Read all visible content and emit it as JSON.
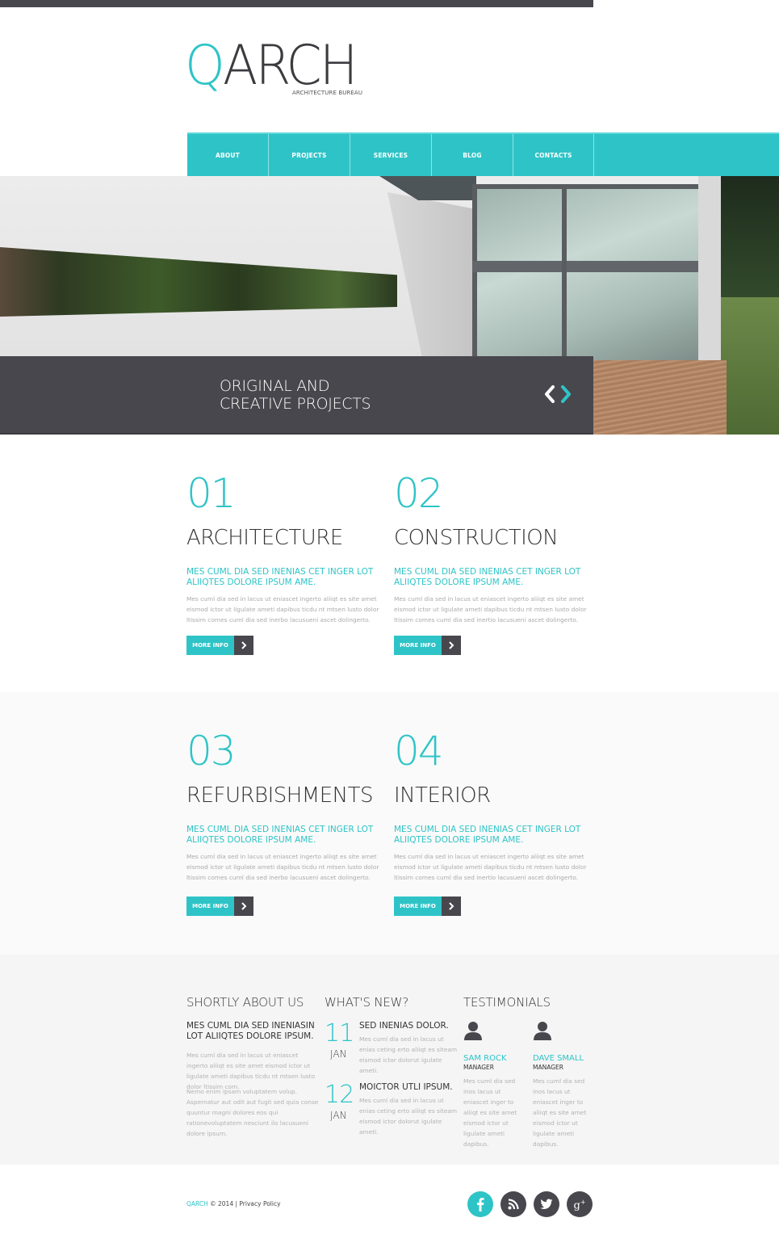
{
  "brand": {
    "logo_q": "Q",
    "logo_rest": "ARCH",
    "tagline": "ARCHITECTURE BUREAU",
    "accent_color": "#2ec4c7",
    "dark_color": "#48474d"
  },
  "nav": {
    "items": [
      {
        "label": "ABOUT"
      },
      {
        "label": "PROJECTS"
      },
      {
        "label": "SERVICES"
      },
      {
        "label": "BLOG"
      },
      {
        "label": "CONTACTS"
      }
    ]
  },
  "hero": {
    "caption_line1": "ORIGINAL AND",
    "caption_line2": "CREATIVE PROJECTS",
    "prev_icon": "chevron-left-icon",
    "next_icon": "chevron-right-icon"
  },
  "services": [
    {
      "number": "01",
      "title": "ARCHITECTURE",
      "subtitle": "MES CUML DIA SED INENIAS CET INGER LOT ALIIQTES DOLORE IPSUM AME.",
      "body": "Mes cuml dia sed in lacus ut eniascet ingerto aliiqt es site amet eismod ictor ut ligulate ameti dapibus ticdu nt mtsen lusto dolor ltissim comes cuml dia sed inerbo lacusueni ascet dolingerto.",
      "button": "MORE INFO"
    },
    {
      "number": "02",
      "title": "CONSTRUCTION",
      "subtitle": "MES CUML DIA SED INENIAS CET INGER LOT ALIIQTES DOLORE IPSUM AME.",
      "body": "Mes cuml dia sed in lacus ut eniascet ingerto aliiqt es site amet eismod ictor ut ligulate ameti dapibus ticdu nt mtsen lusto dolor ltissim comes cuml dia sed inertio lacusueni ascet dolingerto.",
      "button": "MORE INFO"
    },
    {
      "number": "03",
      "title": "REFURBISHMENTS",
      "subtitle": "MES CUML DIA SED INENIAS CET INGER LOT ALIIQTES DOLORE IPSUM AME.",
      "body": "Mes cuml dia sed in lacus ut eniascet ingerto aliiqt es site amet eismod ictor ut ligulate ameti dapibus ticdu nt mtsen lusto dolor ltissim comes cuml dia sed inerbo lacusueni ascet dolingerto.",
      "button": "MORE INFO"
    },
    {
      "number": "04",
      "title": "INTERIOR",
      "subtitle": "MES CUML DIA SED INENIAS CET INGER LOT ALIIQTES DOLORE IPSUM AME.",
      "body": "Mes cuml dia sed in lacus ut eniascet ingerto aliiqt es site amet eismod ictor ut ligulate ameti dapibus ticdu nt mtsen lusto dolor ltissim comes cuml dia sed inertio lacusueni ascet dolingerto.",
      "button": "MORE INFO"
    }
  ],
  "about": {
    "title": "SHORTLY ABOUT US",
    "subtitle": "MES CUML DIA SED INENIASIN LOT ALIIQTES DOLORE IPSUM.",
    "p1": "Mes cuml dia sed in lacus ut eniascet ingerto aliiqt es site amet eismod ictor ut ligulate ameti dapibus ticdu nt mtsen lusto dolor ltissim com.",
    "p2": "Nemo enim ipsam voluptatem volup. Aspernatur aut odit aut fugit sed quia conse quuntur magni dolores eos qui rationevoluptatem nesciunt ilo lacusueni dolore ipsum."
  },
  "news": {
    "title": "WHAT'S NEW?",
    "items": [
      {
        "day": "11",
        "month": "JAN",
        "title": "SED INENIAS DOLOR.",
        "body": "Mes cuml dia sed in lacus ut enias ceting erto aliiqt es siteam eismod ictor dolorut igulate ameti."
      },
      {
        "day": "12",
        "month": "JAN",
        "title": "MOICTOR UTLI IPSUM.",
        "body": "Mes cuml dia sed in lacus ut enias ceting erto aliiqt es siteam eismod ictor dolorut igulate ameti."
      }
    ]
  },
  "testimonials": {
    "title": "TESTIMONIALS",
    "items": [
      {
        "name": "SAM ROCK",
        "role": "MANAGER",
        "body": "Mes cuml dia sed inos lacus ut eniascet inger to aliiqt es site amet eismod ictor ut ligulate ameti dapibus."
      },
      {
        "name": "DAVE SMALL",
        "role": "MANAGER",
        "body": "Mes cuml dia sed inos lacus ut eniascet inger to aliiqt es site amet eismod ictor ut ligulate ameti dapibus."
      }
    ]
  },
  "footer": {
    "brand": "QARCH",
    "copyright": " © 2014 | ",
    "privacy": "Privacy Policy",
    "socials": [
      {
        "name": "facebook",
        "icon": "facebook-icon"
      },
      {
        "name": "rss",
        "icon": "rss-icon"
      },
      {
        "name": "twitter",
        "icon": "twitter-icon"
      },
      {
        "name": "google-plus",
        "icon": "google-plus-icon"
      }
    ]
  }
}
